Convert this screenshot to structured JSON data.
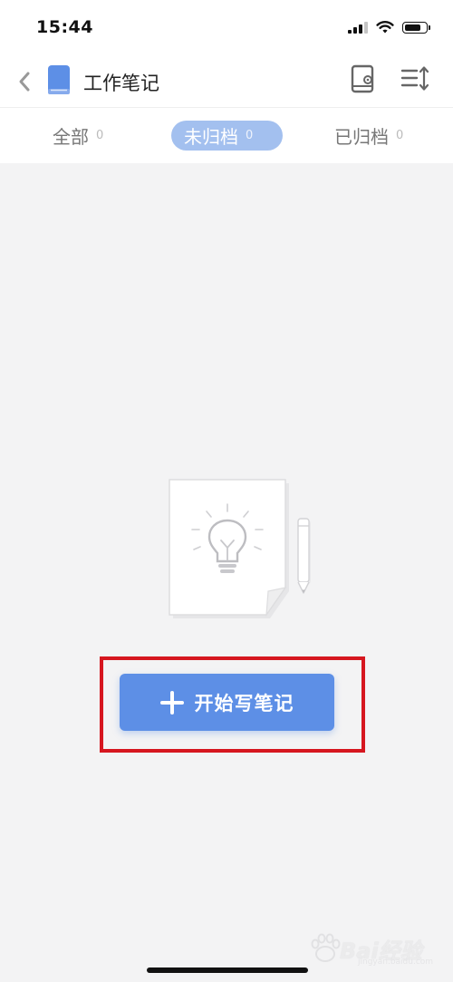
{
  "status_bar": {
    "time": "15:44",
    "signal_level": 0.75,
    "battery_level": 0.8,
    "icons": [
      "cellular-signal-icon",
      "wifi-icon",
      "battery-icon"
    ]
  },
  "nav": {
    "title": "工作笔记",
    "icons": [
      "back-chevron-icon",
      "notebook-icon",
      "notebook-settings-icon",
      "sort-icon"
    ]
  },
  "tabs": [
    {
      "label": "全部",
      "count": "0",
      "active": false
    },
    {
      "label": "未归档",
      "count": "0",
      "active": true
    },
    {
      "label": "已归档",
      "count": "0",
      "active": false
    }
  ],
  "empty_state": {
    "illustration": "lightbulb-document-with-pencil",
    "button_label": "开始写笔记",
    "button_icon": "plus-icon"
  },
  "watermark": {
    "text": "Bai经验",
    "sub": "jingyan.baidu.com"
  },
  "colors": {
    "accent": "#5d8fe6",
    "active_tab_bg": "#a3c0ef",
    "highlight_border": "#d6161f",
    "notebook_icon": "#5d8fe6",
    "background": "#f3f3f4"
  }
}
